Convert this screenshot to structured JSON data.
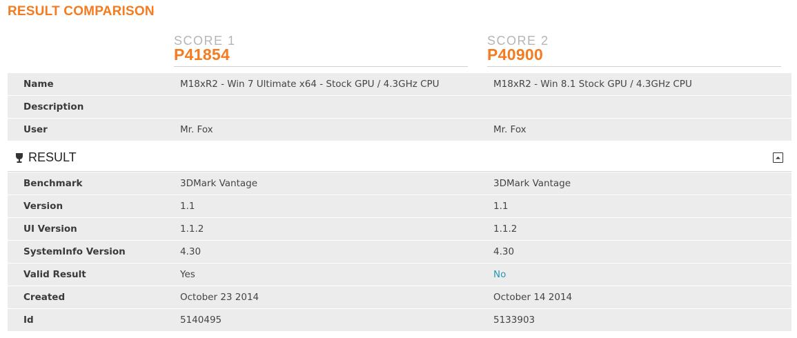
{
  "page": {
    "title": "RESULT COMPARISON"
  },
  "scores": [
    {
      "label": "SCORE 1",
      "value": "P41854"
    },
    {
      "label": "SCORE 2",
      "value": "P40900"
    }
  ],
  "details": {
    "rows": [
      {
        "label": "Name",
        "v1": "M18xR2 - Win 7 Ultimate x64 - Stock GPU / 4.3GHz CPU",
        "v2": "M18xR2 - Win 8.1 Stock GPU / 4.3GHz CPU"
      },
      {
        "label": "Description",
        "v1": "",
        "v2": ""
      },
      {
        "label": "User",
        "v1": "Mr. Fox",
        "v2": "Mr. Fox"
      }
    ]
  },
  "result_section": {
    "title": "RESULT",
    "icon": "trophy-icon",
    "toggle_icon": "collapse-icon",
    "rows": [
      {
        "label": "Benchmark",
        "v1": "3DMark Vantage",
        "v2": "3DMark Vantage"
      },
      {
        "label": "Version",
        "v1": "1.1",
        "v2": "1.1"
      },
      {
        "label": "UI Version",
        "v1": "1.1.2",
        "v2": "1.1.2"
      },
      {
        "label": "SystemInfo Version",
        "v1": "4.30",
        "v2": "4.30"
      },
      {
        "label": "Valid Result",
        "v1": "Yes",
        "v2": "No"
      },
      {
        "label": "Created",
        "v1": "October 23 2014",
        "v2": "October 14 2014"
      },
      {
        "label": "Id",
        "v1": "5140495",
        "v2": "5133903"
      }
    ]
  },
  "colors": {
    "accent": "#f47b20",
    "link": "#2b95b5",
    "row_bg": "#ececec"
  }
}
